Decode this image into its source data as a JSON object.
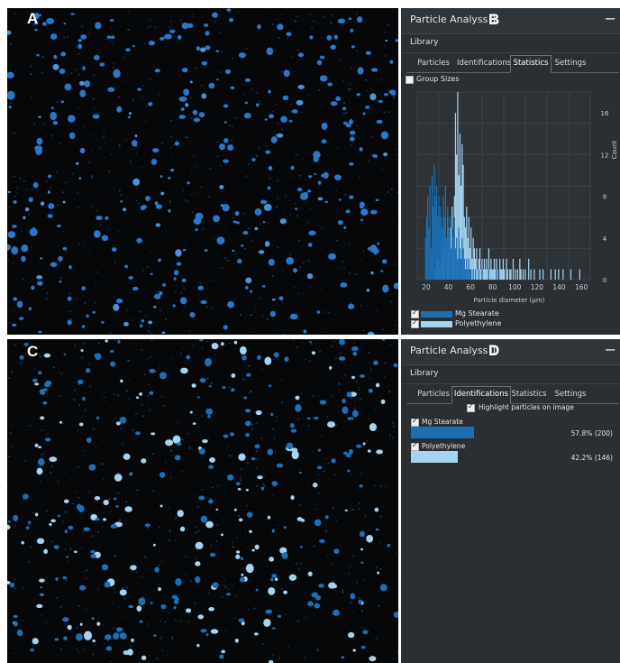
{
  "panels": {
    "a_letter": "A",
    "b_letter": "B",
    "c_letter": "C",
    "d_letter": "D"
  },
  "window": {
    "title": "Particle Analyss 1",
    "minimize": "−"
  },
  "library_label": "Library",
  "tabs": [
    "Particles",
    "Identifications",
    "Statistics",
    "Settings"
  ],
  "stats_panel": {
    "active_tab": "Statistics",
    "group_sizes_label": "Group Sizes",
    "group_sizes_checked": false
  },
  "ids_panel": {
    "active_tab": "Identifications",
    "highlight_label": "Highlight particles on image",
    "highlight_checked": true,
    "items": [
      {
        "name": "Mg Stearate",
        "checked": true,
        "percent_text": "57.8%  (200)",
        "fraction": 0.578,
        "color": "#1b6fb4"
      },
      {
        "name": "Polyethylene",
        "checked": true,
        "percent_text": "42.2%  (146)",
        "fraction": 0.422,
        "color": "#a6d3ef"
      }
    ]
  },
  "colors": {
    "mg_stearate": "#1b6fb4",
    "polyethylene": "#a6d3ef",
    "image_background": "#060708"
  },
  "chart_data": {
    "type": "bar",
    "xlabel": "Particle diameter (µm)",
    "ylabel": "Count",
    "x_ticks": [
      "20",
      "40",
      "60",
      "80",
      "100",
      "120",
      "140",
      "160"
    ],
    "y_ticks": [
      "16",
      "12",
      "8",
      "4",
      "0"
    ],
    "xlim": [
      12,
      168
    ],
    "ylim": [
      0,
      18
    ],
    "legend_position": "bottom-left",
    "grid": true,
    "x": [
      19,
      20,
      21,
      22,
      23,
      24,
      25,
      26,
      27,
      28,
      29,
      30,
      31,
      32,
      33,
      34,
      35,
      36,
      37,
      38,
      39,
      40,
      41,
      42,
      43,
      44,
      45,
      46,
      47,
      48,
      49,
      50,
      51,
      52,
      53,
      54,
      55,
      56,
      57,
      58,
      59,
      60,
      61,
      62,
      63,
      64,
      65,
      66,
      67,
      68,
      69,
      70,
      71,
      72,
      73,
      74,
      75,
      76,
      77,
      78,
      79,
      80,
      81,
      82,
      83,
      84,
      85,
      86,
      87,
      88,
      89,
      90,
      91,
      92,
      93,
      94,
      95,
      96,
      97,
      98,
      99,
      100,
      101,
      102,
      103,
      104,
      105,
      106,
      107,
      108,
      109,
      110,
      111,
      112,
      113,
      114,
      115,
      116,
      117,
      118,
      119,
      120,
      121,
      122,
      123,
      124,
      125,
      126,
      127,
      128,
      129,
      130,
      131,
      132,
      133,
      134,
      135,
      136,
      137,
      138,
      139,
      140,
      141,
      142,
      143,
      144,
      145,
      146,
      147,
      148,
      149,
      150,
      151,
      152,
      153,
      154,
      155,
      156,
      157,
      158,
      159,
      160,
      161,
      162,
      163,
      164,
      165
    ],
    "series": [
      {
        "name": "Mg Stearate",
        "color": "#1b6fb4",
        "values": [
          4,
          6,
          8,
          5,
          9,
          3,
          10,
          7,
          11,
          8,
          9,
          6,
          8,
          7,
          6,
          5,
          8,
          6,
          9,
          4,
          7,
          5,
          6,
          3,
          5,
          4,
          6,
          3,
          4,
          2,
          5,
          3,
          2,
          4,
          3,
          2,
          1,
          2,
          1,
          2,
          1,
          1,
          0,
          1,
          0,
          1,
          0,
          0,
          1,
          0,
          0,
          1,
          0,
          0,
          0,
          0,
          0,
          1,
          0,
          0,
          0,
          0,
          0,
          0,
          1,
          0,
          0,
          0,
          0,
          0,
          0,
          0,
          0,
          0,
          0,
          0,
          0,
          0,
          0,
          0,
          0,
          0,
          0,
          0,
          0,
          0,
          0,
          0,
          0,
          0,
          0,
          0,
          0,
          0,
          0,
          0,
          0,
          0,
          0,
          0,
          0,
          0,
          0,
          0,
          0,
          0,
          0,
          0,
          0,
          0,
          0,
          0,
          0,
          0,
          0,
          0,
          0,
          0,
          0,
          0,
          0,
          0,
          0,
          0,
          0,
          0,
          0,
          0,
          0,
          0,
          0,
          0,
          0,
          0,
          0,
          0,
          0,
          0,
          0,
          0,
          0,
          0,
          0,
          0,
          0,
          0,
          0
        ]
      },
      {
        "name": "Polyethylene",
        "color": "#a6d3ef",
        "values": [
          0,
          0,
          0,
          0,
          0,
          0,
          0,
          0,
          0,
          1,
          0,
          2,
          0,
          1,
          3,
          2,
          4,
          3,
          5,
          2,
          6,
          4,
          3,
          5,
          7,
          4,
          8,
          16,
          12,
          18,
          10,
          14,
          9,
          13,
          11,
          6,
          5,
          7,
          4,
          6,
          3,
          5,
          2,
          4,
          3,
          2,
          3,
          1,
          2,
          3,
          1,
          2,
          1,
          2,
          1,
          2,
          1,
          3,
          1,
          2,
          1,
          1,
          2,
          1,
          2,
          1,
          0,
          2,
          1,
          1,
          2,
          1,
          0,
          2,
          1,
          0,
          1,
          1,
          0,
          2,
          0,
          1,
          0,
          1,
          0,
          2,
          1,
          0,
          1,
          0,
          1,
          0,
          0,
          2,
          0,
          1,
          0,
          0,
          1,
          0,
          0,
          0,
          0,
          1,
          0,
          0,
          1,
          0,
          0,
          0,
          0,
          0,
          0,
          1,
          0,
          0,
          0,
          1,
          0,
          0,
          1,
          0,
          0,
          0,
          1,
          0,
          0,
          0,
          0,
          0,
          0,
          1,
          0,
          0,
          0,
          0,
          0,
          0,
          0,
          1,
          0,
          0,
          0,
          0,
          0,
          0,
          0
        ]
      }
    ]
  }
}
